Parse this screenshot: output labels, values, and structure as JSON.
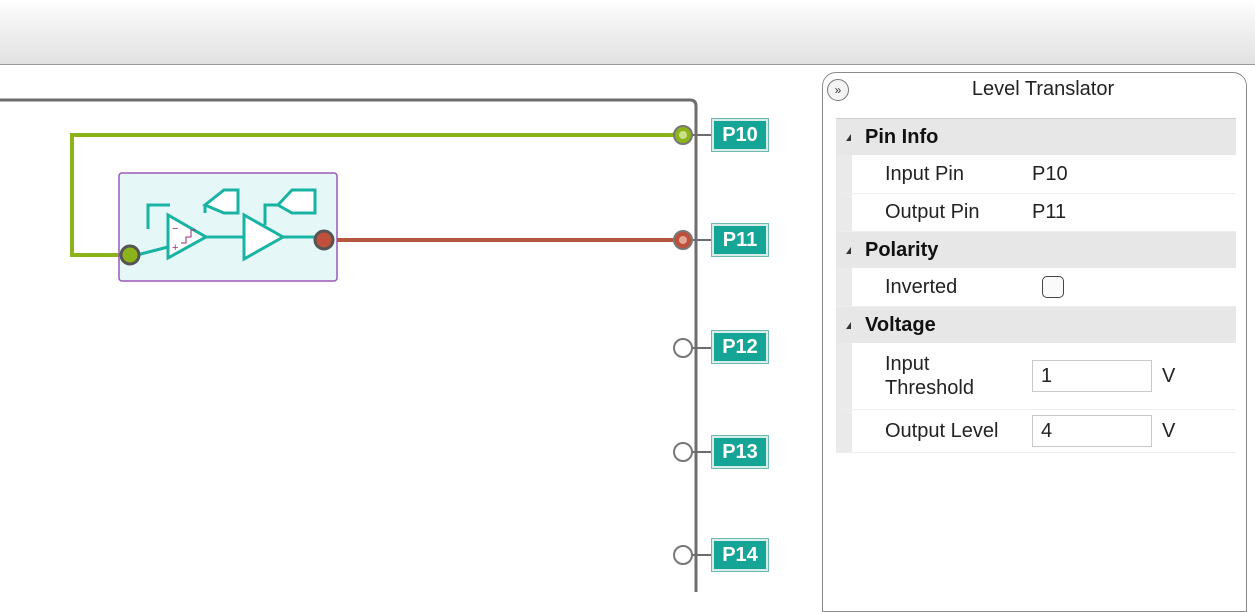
{
  "window": {
    "toolbar": ""
  },
  "canvas": {
    "pins": [
      {
        "label": "P10",
        "state": "connected-input"
      },
      {
        "label": "P11",
        "state": "connected-output"
      },
      {
        "label": "P12",
        "state": "open"
      },
      {
        "label": "P13",
        "state": "open"
      },
      {
        "label": "P14",
        "state": "open"
      }
    ],
    "component": {
      "icon": "level-translator-icon"
    },
    "wires": [
      {
        "from": "P10",
        "to": "component-input",
        "color": "#8db31a"
      },
      {
        "from": "component-output",
        "to": "P11",
        "color": "#b5563e"
      }
    ],
    "colors": {
      "pin_label_bg": "#14a596",
      "chip_border": "#9b59b6",
      "chip_bg": "#e6f7f8",
      "chip_stroke": "#19b3a3",
      "frame": "#6d6d6d"
    }
  },
  "panel": {
    "collapse_icon": "double-chevron-right-icon",
    "title": "Level Translator",
    "sections": {
      "pin_info": {
        "label": "Pin Info",
        "input_pin_label": "Input Pin",
        "input_pin_value": "P10",
        "output_pin_label": "Output Pin",
        "output_pin_value": "P11"
      },
      "polarity": {
        "label": "Polarity",
        "inverted_label": "Inverted",
        "inverted_checked": false
      },
      "voltage": {
        "label": "Voltage",
        "input_threshold_label": "Input Threshold",
        "input_threshold_value": "1",
        "input_threshold_unit": "V",
        "output_level_label": "Output Level",
        "output_level_value": "4",
        "output_level_unit": "V"
      }
    }
  }
}
